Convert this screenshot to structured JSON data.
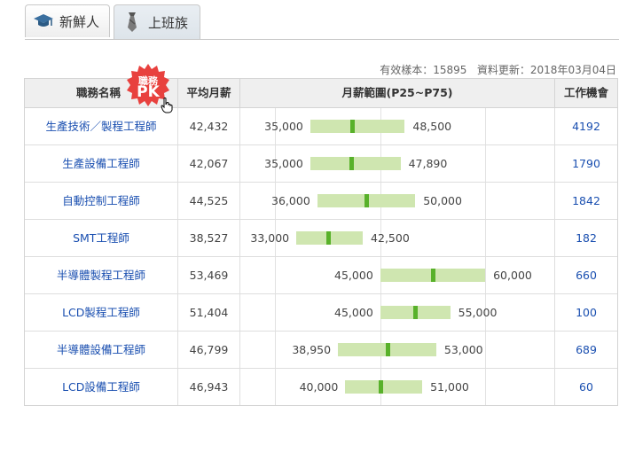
{
  "tabs": [
    {
      "label": "新鮮人",
      "icon": "graduation-cap-icon",
      "active": false
    },
    {
      "label": "上班族",
      "icon": "necktie-icon",
      "active": true
    }
  ],
  "meta": {
    "sample_label": "有效樣本：",
    "sample_value": "15895",
    "update_label": "資料更新：",
    "update_value": "2018年03月04日"
  },
  "table": {
    "headers": {
      "job": "職務名稱",
      "avg": "平均月薪",
      "range": "月薪範圍(P25~P75)",
      "jobs": "工作機會"
    },
    "pk_badge": {
      "line1": "職務",
      "line2": "PK"
    },
    "rows": [
      {
        "job": "生產技術／製程工程師",
        "avg": "42,432",
        "p25": 35000,
        "p75": 48500,
        "p25_label": "35,000",
        "p75_label": "48,500",
        "median": 41000,
        "count": "4192"
      },
      {
        "job": "生產設備工程師",
        "avg": "42,067",
        "p25": 35000,
        "p75": 47890,
        "p25_label": "35,000",
        "p75_label": "47,890",
        "median": 40800,
        "count": "1790"
      },
      {
        "job": "自動控制工程師",
        "avg": "44,525",
        "p25": 36000,
        "p75": 50000,
        "p25_label": "36,000",
        "p75_label": "50,000",
        "median": 43000,
        "count": "1842"
      },
      {
        "job": "SMT工程師",
        "avg": "38,527",
        "p25": 33000,
        "p75": 42500,
        "p25_label": "33,000",
        "p75_label": "42,500",
        "median": 37500,
        "count": "182"
      },
      {
        "job": "半導體製程工程師",
        "avg": "53,469",
        "p25": 45000,
        "p75": 60000,
        "p25_label": "45,000",
        "p75_label": "60,000",
        "median": 52500,
        "count": "660"
      },
      {
        "job": "LCD製程工程師",
        "avg": "51,404",
        "p25": 45000,
        "p75": 55000,
        "p25_label": "45,000",
        "p75_label": "55,000",
        "median": 50000,
        "count": "100"
      },
      {
        "job": "半導體設備工程師",
        "avg": "46,799",
        "p25": 38950,
        "p75": 53000,
        "p25_label": "38,950",
        "p75_label": "53,000",
        "median": 46000,
        "count": "689"
      },
      {
        "job": "LCD設備工程師",
        "avg": "46,943",
        "p25": 40000,
        "p75": 51000,
        "p25_label": "40,000",
        "p75_label": "51,000",
        "median": 45000,
        "count": "60"
      }
    ]
  },
  "colors": {
    "link": "#1a4fb0",
    "bar": "#cfe6b0",
    "median": "#58b12a",
    "pk": "#e8413e"
  }
}
